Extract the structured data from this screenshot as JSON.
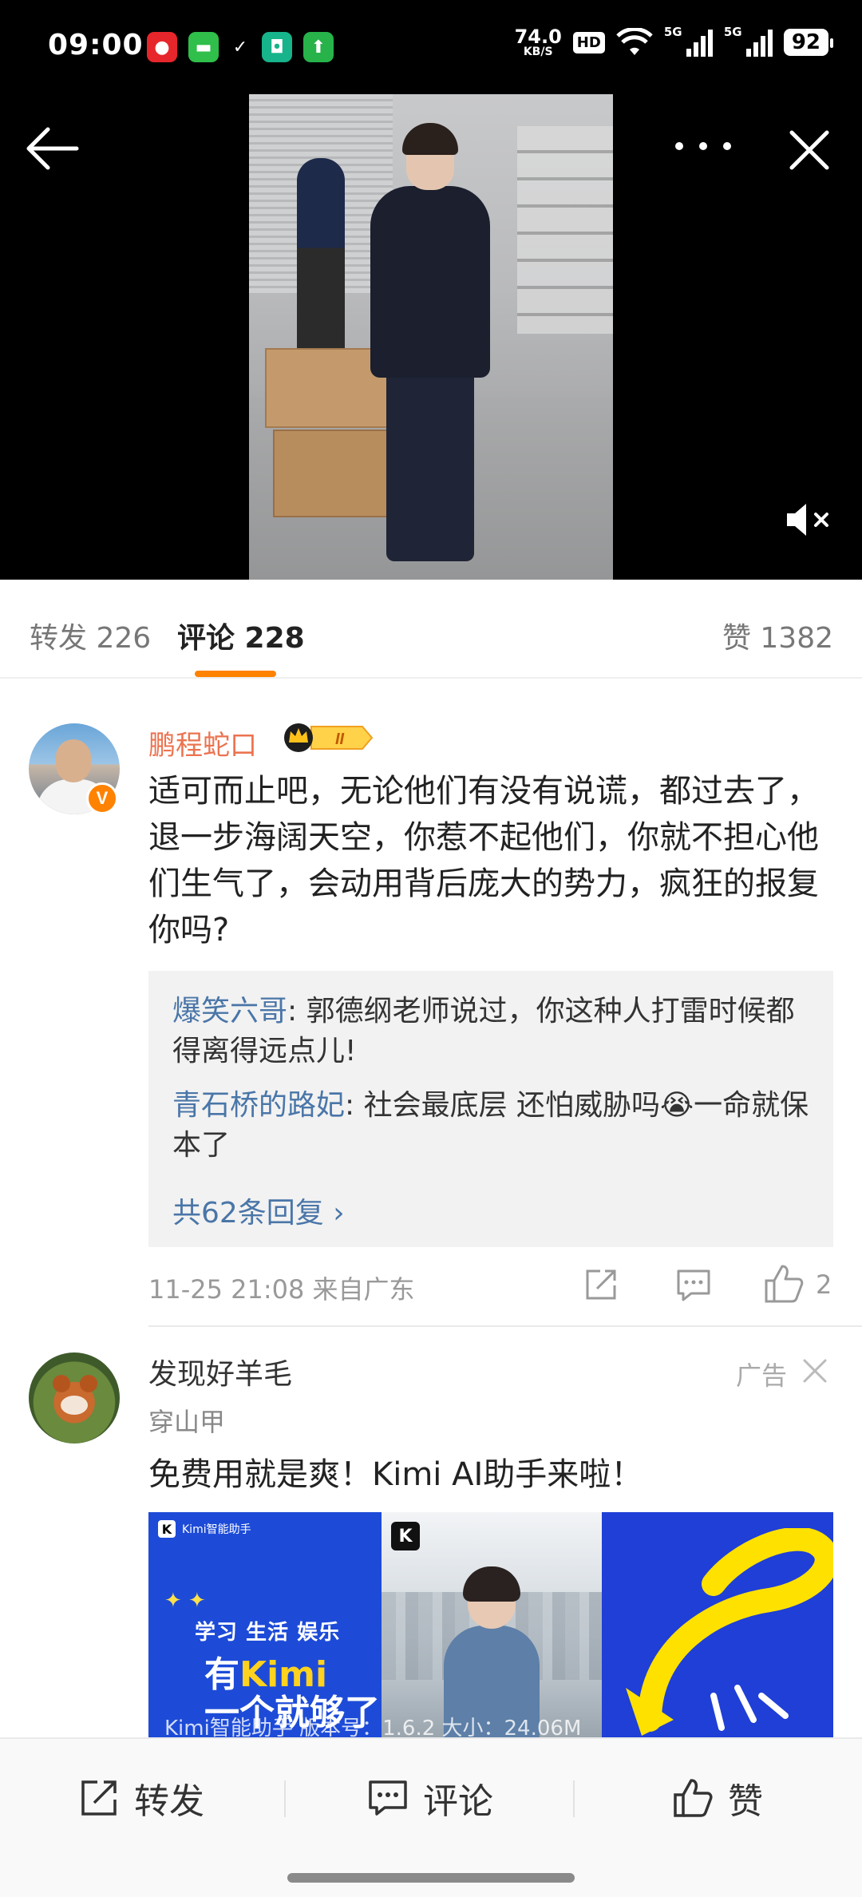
{
  "status_bar": {
    "time": "09:00",
    "net_speed_value": "74.0",
    "net_speed_unit": "KB/S",
    "hd_label": "HD",
    "sim1_label": "5G",
    "sim2_label": "5G",
    "battery": "92",
    "app_icons": [
      "weibo-app-icon",
      "messages-app-icon",
      "check-icon",
      "mi-app-icon",
      "upload-app-icon"
    ]
  },
  "video": {
    "back_icon": "arrow-left-icon",
    "more_icon": "more-dots-icon",
    "close_icon": "close-icon",
    "mute_icon": "speaker-muted-icon"
  },
  "tabs": {
    "repost": "转发 226",
    "comment": "评论 228",
    "like": "赞 1382",
    "active_color": "#ff8200"
  },
  "comment": {
    "author": "鹏程蛇口",
    "verified_badge": "V",
    "rank_badge": "II",
    "text": "适可而止吧，无论他们有没有说谎，都过去了，退一步海阔天空，你惹不起他们，你就不担心他们生气了，会动用背后庞大的势力，疯狂的报复你吗?",
    "replies": [
      {
        "name": "爆笑六哥",
        "text": ": 郭德纲老师说过，你这种人打雷时候都得离得远点儿!"
      },
      {
        "name": "青石桥的路妃",
        "text": ": 社会最底层 还怕威胁吗😭一命就保本了"
      }
    ],
    "more_replies": "共62条回复 ›",
    "meta": "11-25 21:08 来自广东",
    "like_count": "2"
  },
  "ad": {
    "account_name": "发现好羊毛",
    "ad_label": "广告",
    "sub_label": "穿山甲",
    "text": "免费用就是爽！Kimi AI助手来啦！",
    "banner": {
      "brand": "Kimi智能助手",
      "logo_letter": "K",
      "tags": "学习 生活 娱乐",
      "headline_1": "有",
      "headline_brand": "Kimi",
      "headline_2": "一个就够了",
      "caption": "Kimi智能助手  版本号：1.6.2  大小：24.06M"
    }
  },
  "bottom_bar": {
    "repost": "转发",
    "comment": "评论",
    "like": "赞"
  }
}
